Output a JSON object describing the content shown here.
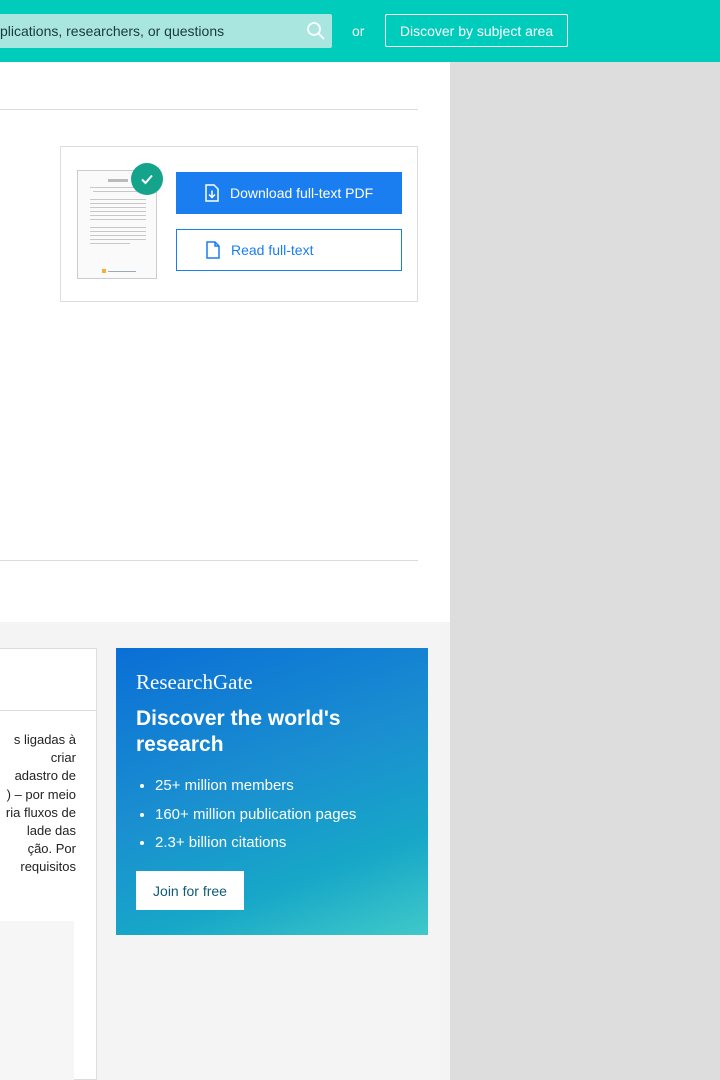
{
  "header": {
    "search_placeholder": "Search for publications, researchers, or questions",
    "search_visible_text": "plications, researchers, or questions",
    "or_text": "or",
    "discover_label": "Discover by subject area"
  },
  "fulltext_card": {
    "download_label": "Download full-text PDF",
    "read_label": "Read full-text"
  },
  "snippet": {
    "lines": [
      "s ligadas à",
      "criar",
      "adastro de",
      ") – por meio",
      "ria fluxos de",
      "lade das",
      "ção. Por",
      "requisitos"
    ]
  },
  "promo": {
    "logo": "ResearchGate",
    "title": "Discover the world's research",
    "items": [
      "25+ million members",
      "160+ million publication pages",
      "2.3+ billion citations"
    ],
    "join_label": "Join for free"
  },
  "colors": {
    "topbar": "#00ccbb",
    "primary_blue": "#1a7ef0",
    "check_green": "#14a38b"
  }
}
